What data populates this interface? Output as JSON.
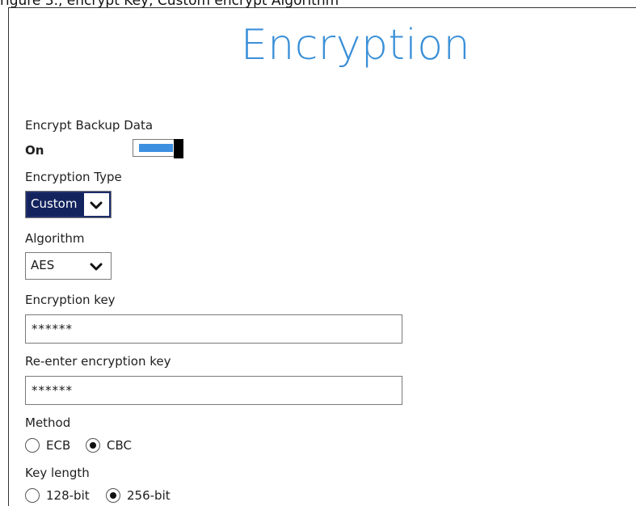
{
  "caption": "rigure 3., encrypt Key, Custom encrypt Algorithm",
  "header": {
    "title": "Encryption"
  },
  "encrypt_backup": {
    "label": "Encrypt Backup Data",
    "state_text": "On",
    "enabled": true
  },
  "encryption_type": {
    "label": "Encryption Type",
    "selected": "Custom"
  },
  "algorithm": {
    "label": "Algorithm",
    "selected": "AES"
  },
  "encryption_key": {
    "label": "Encryption key",
    "value": "******"
  },
  "reenter_key": {
    "label": "Re-enter encryption key",
    "value": "******"
  },
  "method": {
    "label": "Method",
    "options": [
      {
        "label": "ECB",
        "checked": false
      },
      {
        "label": "CBC",
        "checked": true
      }
    ]
  },
  "key_length": {
    "label": "Key length",
    "options": [
      {
        "label": "128-bit",
        "checked": false
      },
      {
        "label": "256-bit",
        "checked": true
      }
    ]
  },
  "colors": {
    "title": "#3a8fd8",
    "toggle_track": "#3d8fe0",
    "selected_bg": "#13235e"
  }
}
